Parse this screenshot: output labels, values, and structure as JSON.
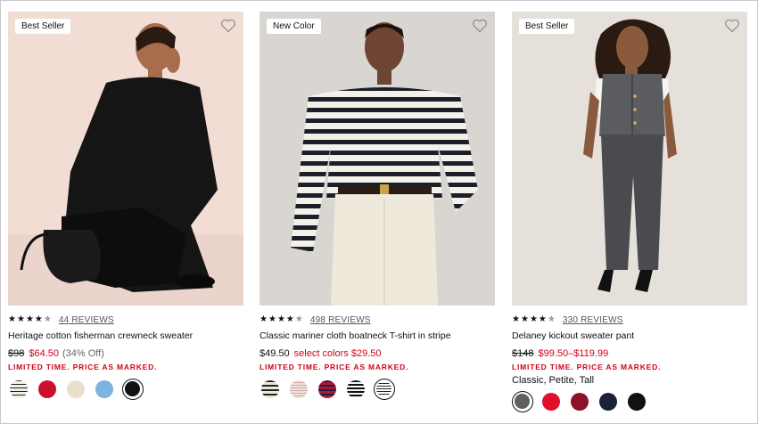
{
  "products": [
    {
      "badge": "Best Seller",
      "rating": 4.5,
      "reviews": "44 REVIEWS",
      "name": "Heritage cotton fisherman crewneck sweater",
      "price_was": "$98",
      "price_now": "$64.50",
      "price_off": "(34% Off)",
      "limited": "LIMITED TIME. PRICE AS MARKED.",
      "swatches": [
        "cream-stripe",
        "red",
        "natural",
        "light-blue",
        "black"
      ],
      "selected_swatch": "black"
    },
    {
      "badge": "New Color",
      "rating": 4.5,
      "reviews": "498 REVIEWS",
      "name": "Classic mariner cloth boatneck T-shirt in stripe",
      "price_regular": "$49.50",
      "price_select": "select colors $29.50",
      "limited": "LIMITED TIME. PRICE AS MARKED.",
      "swatches": [
        "navy-cream-stripe",
        "pink-stripe",
        "red-navy-stripe",
        "black-white-stripe",
        "black-white-stripe-2"
      ],
      "selected_swatch": "black-white-stripe-2"
    },
    {
      "badge": "Best Seller",
      "rating": 4.5,
      "reviews": "330 REVIEWS",
      "name": "Delaney kickout sweater pant",
      "price_was": "$148",
      "price_range": "$99.50–$119.99",
      "limited": "LIMITED TIME. PRICE AS MARKED.",
      "sizes": "Classic, Petite, Tall",
      "swatches": [
        "charcoal",
        "red",
        "burgundy",
        "navy",
        "black"
      ],
      "selected_swatch": "charcoal"
    }
  ],
  "colors": {
    "sale_red": "#d0021b",
    "text": "#111111"
  },
  "icons": {
    "favorite": "heart-outline-icon",
    "star": "star-icon"
  }
}
